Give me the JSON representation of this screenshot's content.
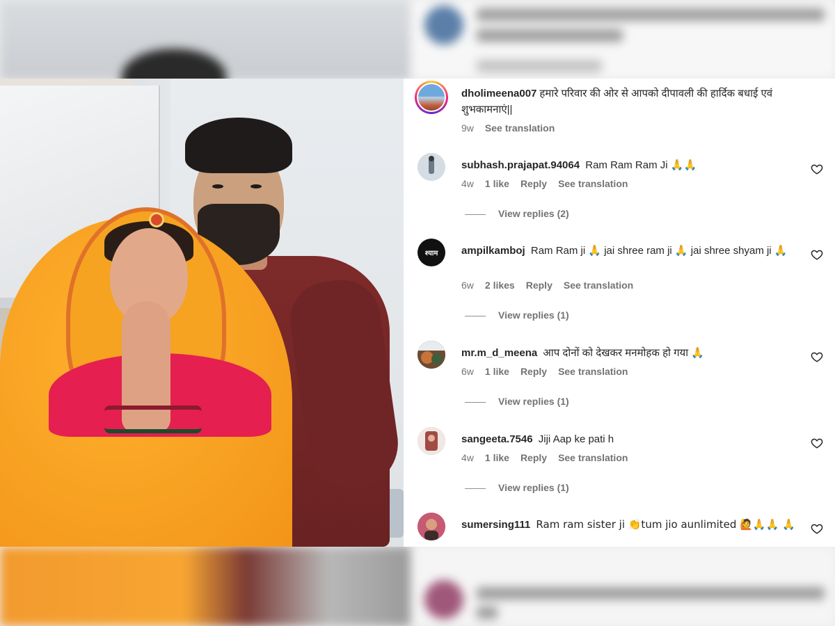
{
  "top_comment": {
    "username": "dholimeena007",
    "text": "हमारे परिवार की ओर से आपको दीपावली की हार्दिक बधाई एवं शुभकामनाएं||",
    "age": "9w",
    "see_translation": "See translation"
  },
  "comments": [
    {
      "username": "subhash.prajapat.94064",
      "text": "Ram Ram Ram Ji",
      "emoji": "🙏🙏",
      "age": "4w",
      "likes": "1 like",
      "reply_label": "Reply",
      "see_translation": "See translation",
      "view_replies": "View replies (2)",
      "avatar_color": "#c9d3dc"
    },
    {
      "username": "ampilkamboj",
      "text": "Ram Ram ji 🙏 jai shree ram ji 🙏 jai shree shyam ji 🙏",
      "age": "6w",
      "likes": "2 likes",
      "reply_label": "Reply",
      "see_translation": "See translation",
      "view_replies": "View replies (1)",
      "avatar_color": "#111111",
      "avatar_text": "श्याम"
    },
    {
      "username": "mr.m_d_meena",
      "text": "आप दोनों को देखकर मनमोहक हो गया",
      "emoji": "🙏",
      "age": "6w",
      "likes": "1 like",
      "reply_label": "Reply",
      "see_translation": "See translation",
      "view_replies": "View replies (1)",
      "avatar_color": "#8a5a3a"
    },
    {
      "username": "sangeeta.7546",
      "text": "Jiji Aap ke pati h",
      "age": "4w",
      "likes": "1 like",
      "reply_label": "Reply",
      "see_translation": "See translation",
      "view_replies": "View replies (1)",
      "avatar_color": "#b9897a"
    },
    {
      "username": "sumersing111",
      "text": "Ram ram sister ji 👏tum jio aunlimited 🙋🙏🙏 🙏",
      "avatar_color": "#c0546b"
    }
  ],
  "colors": {
    "username": "#262626",
    "meta": "#737373",
    "accent_ring": "#ee2a7b"
  },
  "icons": {
    "like": "heart-outline-icon"
  }
}
